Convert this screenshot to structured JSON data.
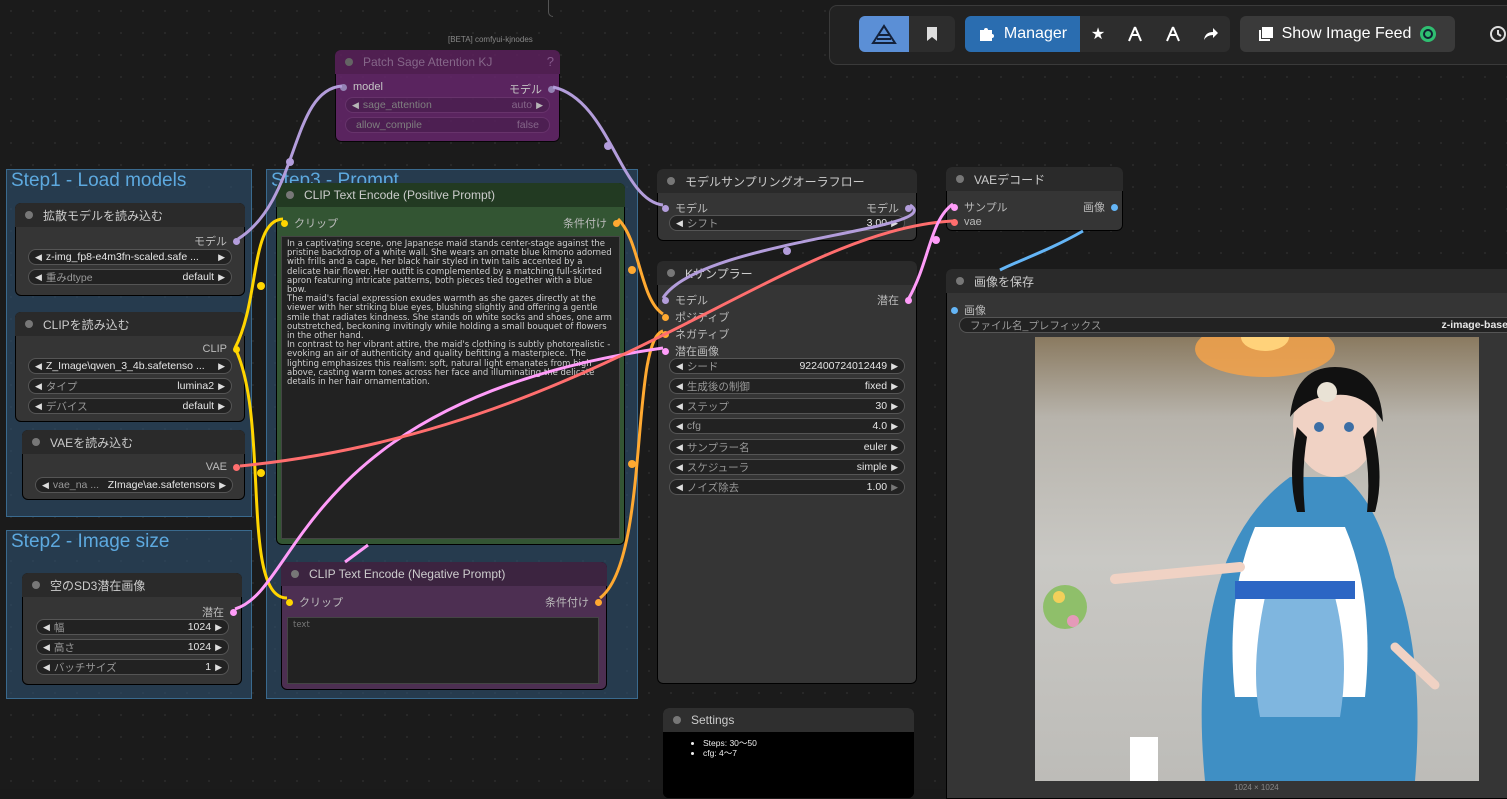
{
  "topbar": {
    "manager_label": "Manager",
    "image_feed_label": "Show Image Feed",
    "icons": [
      "workflow-logo-icon",
      "bookmark-icon",
      "puzzle-icon",
      "star-icon",
      "model-manager-icon",
      "model-download-icon",
      "share-icon",
      "image-feed-icon",
      "feed-badge-icon",
      "history-icon"
    ]
  },
  "groups": {
    "step1": "Step1 - Load models",
    "step2": "Step2 - Image size",
    "step3": "Step3 - Prompt"
  },
  "sage_node": {
    "badge": "[BETA] comfyui-kjnodes",
    "title": "Patch Sage Attention KJ",
    "help": "?",
    "in_model": "model",
    "out_model": "モデル",
    "w1_label": "sage_attention",
    "w1_value": "auto",
    "w2_label": "allow_compile",
    "w2_value": "false"
  },
  "diffusion_node": {
    "title": "拡散モデルを読み込む",
    "out": "モデル",
    "w1_value": "z-img_fp8-e4m3fn-scaled.safe ...",
    "w2_label": "重みdtype",
    "w2_value": "default"
  },
  "clip_loader": {
    "title": "CLIPを読み込む",
    "out": "CLIP",
    "w1_value": "Z_Image\\qwen_3_4b.safetenso ...",
    "w2_label": "タイプ",
    "w2_value": "lumina2",
    "w3_label": "デバイス",
    "w3_value": "default"
  },
  "vae_loader": {
    "title": "VAEを読み込む",
    "out": "VAE",
    "w1_label": "vae_na ...",
    "w1_value": "ZImage\\ae.safetensors"
  },
  "latent_node": {
    "title": "空のSD3潜在画像",
    "out": "潜在",
    "w1_label": "幅",
    "w1_value": "1024",
    "w2_label": "高さ",
    "w2_value": "1024",
    "w3_label": "バッチサイズ",
    "w3_value": "1"
  },
  "pos_prompt": {
    "title": "CLIP Text Encode (Positive Prompt)",
    "in_clip": "クリップ",
    "out_cond": "条件付け",
    "text": "In a captivating scene, one Japanese maid stands center-stage against the pristine backdrop of a white wall. She wears an ornate blue kimono adorned with frills and a cape, her black hair styled in twin tails accented by a delicate hair flower. Her outfit is complemented by a matching full-skirted apron featuring intricate patterns, both pieces tied together with a blue bow.\nThe maid's facial expression exudes warmth as she gazes directly at the viewer with her striking blue eyes, blushing slightly and offering a gentle smile that radiates kindness. She stands on white socks and shoes, one arm outstretched, beckoning invitingly while holding a small bouquet of flowers in the other hand.\nIn contrast to her vibrant attire, the maid's clothing is subtly photorealistic - evoking an air of authenticity and quality befitting a masterpiece. The lighting emphasizes this realism: soft, natural light emanates from high above, casting warm tones across her face and illuminating the delicate details in her hair ornamentation."
  },
  "neg_prompt": {
    "title": "CLIP Text Encode (Negative Prompt)",
    "in_clip": "クリップ",
    "out_cond": "条件付け",
    "placeholder": "text"
  },
  "aura_node": {
    "title": "モデルサンプリングオーラフロー",
    "in_model": "モデル",
    "out_model": "モデル",
    "w1_label": "シフト",
    "w1_value": "3.00"
  },
  "ksampler": {
    "title": "Kサンプラー",
    "inputs": [
      "モデル",
      "ポジティブ",
      "ネガティブ",
      "潜在画像"
    ],
    "out": "潜在",
    "seed_label": "シード",
    "seed_value": "922400724012449",
    "control_label": "生成後の制御",
    "control_value": "fixed",
    "steps_label": "ステップ",
    "steps_value": "30",
    "cfg_label": "cfg",
    "cfg_value": "4.0",
    "sampler_label": "サンプラー名",
    "sampler_value": "euler",
    "scheduler_label": "スケジューラ",
    "scheduler_value": "simple",
    "denoise_label": "ノイズ除去",
    "denoise_value": "1.00"
  },
  "vae_decode": {
    "title": "VAEデコード",
    "in_samples": "サンプル",
    "in_vae": "vae",
    "out": "画像"
  },
  "save_node": {
    "title": "画像を保存",
    "in_images": "画像",
    "prefix_label": "ファイル名_プレフィックス",
    "prefix_value": "z-image-base",
    "caption": "1024 × 1024"
  },
  "settings_node": {
    "title": "Settings",
    "items": [
      "Steps: 30～50",
      "cfg: 4～7"
    ]
  },
  "colors": {
    "model": "#b39ddb",
    "clip": "#ffd500",
    "vae": "#ff6e6e",
    "latent": "#ff9cf9",
    "conditioning": "#ffa931",
    "image": "#64b5f6",
    "group": "#305678",
    "manager": "#2a6db0"
  }
}
